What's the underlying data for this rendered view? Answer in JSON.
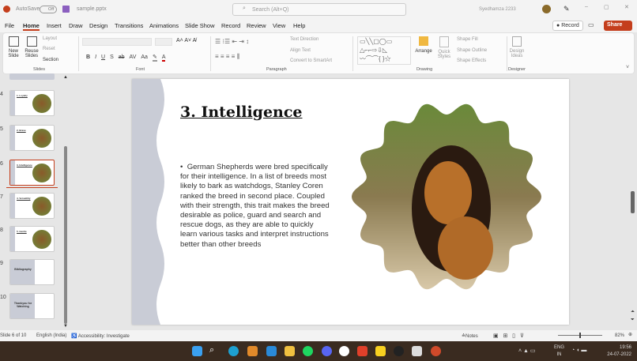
{
  "titlebar": {
    "autosave_label": "AutoSave",
    "autosave_state": "Off",
    "filename": "sample.pptx",
    "search_placeholder": "Search (Alt+Q)",
    "user": "Syedhamza 2233"
  },
  "menu": [
    "File",
    "Home",
    "Insert",
    "Draw",
    "Design",
    "Transitions",
    "Animations",
    "Slide Show",
    "Record",
    "Review",
    "View",
    "Help"
  ],
  "record_label": "Record",
  "share_label": "Share",
  "ribbon": {
    "slides": {
      "new_slide": "New Slide",
      "reuse_slides": "Reuse Slides",
      "layout": "Layout",
      "reset": "Reset",
      "section": "Section",
      "group": "Slides"
    },
    "font": {
      "group": "Font",
      "buttons": [
        "B",
        "I",
        "U",
        "S",
        "ab",
        "AV",
        "Aa"
      ]
    },
    "paragraph": {
      "group": "Paragraph",
      "text_direction": "Text Direction",
      "align_text": "Align Text",
      "convert": "Convert to SmartArt"
    },
    "drawing": {
      "group": "Drawing",
      "arrange": "Arrange",
      "quick_styles": "Quick Styles",
      "shape_fill": "Shape Fill",
      "shape_outline": "Shape Outline",
      "shape_effects": "Shape Effects"
    },
    "designer": {
      "group": "Designer",
      "design_ideas": "Design Ideas"
    }
  },
  "thumbnails": [
    {
      "num": "4",
      "title": "1. Loyalty"
    },
    {
      "num": "5",
      "title": "2. Brave"
    },
    {
      "num": "6",
      "title": "3. Intelligence"
    },
    {
      "num": "7",
      "title": "4. Versatility"
    },
    {
      "num": "8",
      "title": "5. Gentle"
    },
    {
      "num": "9",
      "title": "Bibliography"
    },
    {
      "num": "10",
      "title": "Thankyou for Watching"
    }
  ],
  "slide": {
    "title": "3. Intelligence",
    "body": "German Shepherds were bred specifically for their intelligence. In a list of breeds most likely to bark as watchdogs, Stanley Coren ranked the breed in second place. Coupled with their strength, this trait makes the breed desirable as police, guard and search and rescue dogs, as they are able to quickly learn various tasks and interpret instructions better than other breeds"
  },
  "status": {
    "slide": "Slide 6 of 10",
    "language": "English (India)",
    "accessibility": "Accessibility: Investigate",
    "notes": "Notes",
    "zoom": "82%"
  },
  "taskbar": {
    "lang": "ENG",
    "region": "IN",
    "time": "19:56",
    "date": "24-07-2022"
  }
}
